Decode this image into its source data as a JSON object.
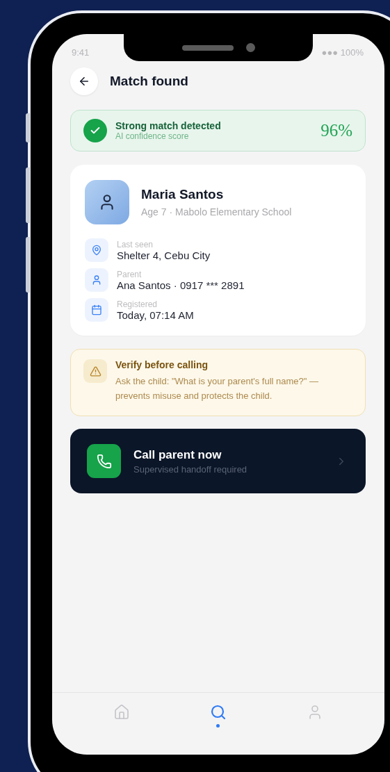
{
  "status_bar": {
    "time": "9:41",
    "battery": "●●● 100%"
  },
  "header": {
    "title": "Match found"
  },
  "match_banner": {
    "title": "Strong match detected",
    "subtitle": "AI confidence score",
    "score": "96%"
  },
  "profile": {
    "name": "Maria Santos",
    "details": "Age 7 · Mabolo Elementary School",
    "fields": [
      {
        "kind": "location",
        "label": "Last seen",
        "value": "Shelter 4, Cebu City"
      },
      {
        "kind": "person",
        "label": "Parent",
        "value": "Ana Santos · 0917 *** 2891"
      },
      {
        "kind": "calendar",
        "label": "Registered",
        "value": "Today, 07:14 AM"
      }
    ]
  },
  "warning": {
    "title": "Verify before calling",
    "text": "Ask the child: \"What is your parent's full name?\" — prevents misuse and protects the child."
  },
  "call_action": {
    "title": "Call parent now",
    "subtitle": "Supervised handoff required"
  },
  "bottom_nav": [
    {
      "kind": "home",
      "selected": false
    },
    {
      "kind": "search",
      "selected": true
    },
    {
      "kind": "profile",
      "selected": false
    }
  ]
}
